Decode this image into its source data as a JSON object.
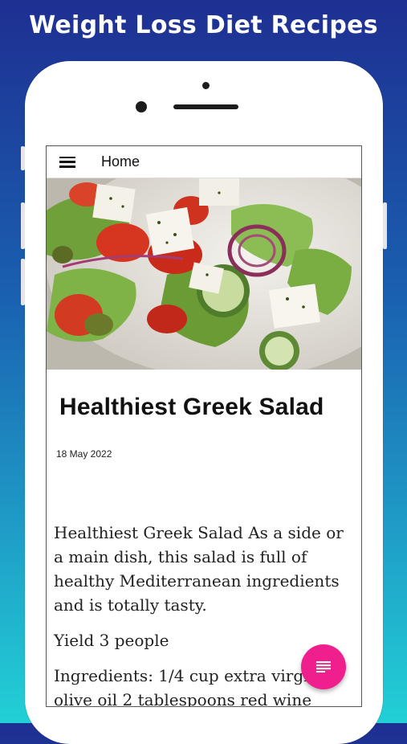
{
  "banner": {
    "title": "Weight Loss Diet Recipes"
  },
  "appbar": {
    "title": "Home",
    "menu_icon": "hamburger-menu-icon"
  },
  "article": {
    "image_alt": "greek-salad-photo",
    "title": "Healthiest Greek Salad",
    "date": "18 May 2022",
    "paragraphs": [
      "Healthiest Greek Salad As a side or a main dish, this salad is full of healthy Mediterranean ingredients and is totally tasty.",
      "Yield 3 people",
      "Ingredients: 1/4 cup extra virgin olive oil 2 tablespoons red wine"
    ]
  },
  "fab": {
    "icon": "list-icon"
  },
  "colors": {
    "accent": "#f01f8e",
    "banner_top": "#1e2f92",
    "banner_bottom": "#22d0d6"
  }
}
